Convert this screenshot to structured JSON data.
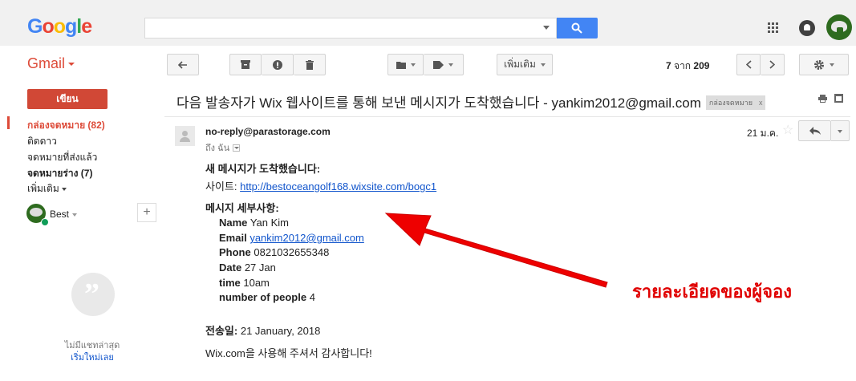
{
  "header": {
    "logo_text": "Google",
    "logo_letters": [
      {
        "ch": "G",
        "color": "#4285f4"
      },
      {
        "ch": "o",
        "color": "#ea4335"
      },
      {
        "ch": "o",
        "color": "#fbbc05"
      },
      {
        "ch": "g",
        "color": "#4285f4"
      },
      {
        "ch": "l",
        "color": "#34a853"
      },
      {
        "ch": "e",
        "color": "#ea4335"
      }
    ],
    "search_value": "",
    "icons": [
      "search-icon",
      "apps-icon",
      "notifications-icon",
      "account-avatar"
    ]
  },
  "toolbar": {
    "gmail_label": "Gmail",
    "more_label": "เพิ่มเติม",
    "page_current": "7",
    "page_sep": "จาก",
    "page_total": "209",
    "icons": [
      "back-icon",
      "archive-icon",
      "report-spam-icon",
      "delete-icon",
      "folder-icon",
      "label-icon",
      "prev-icon",
      "next-icon",
      "settings-icon"
    ]
  },
  "sidebar": {
    "compose_label": "เขียน",
    "items": [
      {
        "label": "กล่องจดหมาย (82)",
        "active": true
      },
      {
        "label": "ติดดาว"
      },
      {
        "label": "จดหมายที่ส่งแล้ว"
      },
      {
        "label": "จดหมายร่าง (7)",
        "bold": true
      },
      {
        "label": "เพิ่มเติม"
      }
    ],
    "hangout_name": "Best",
    "no_chat_text": "ไม่มีแชทล่าสุด",
    "new_chat_link": "เริ่มใหม่เลย"
  },
  "email": {
    "subject": "다음 발송자가 Wix 웹사이트를 통해 보낸 메시지가 도착했습니다 - yankim2012@gmail.com",
    "subject_label": "กล่องจดหมาย",
    "subject_label_close": "x",
    "sender": "no-reply@parastorage.com",
    "to_line": "ถึง ฉัน",
    "date": "21 ม.ค.",
    "body": {
      "heading_new": "새 메시지가 도착했습니다:",
      "site_label": "사이트:",
      "site_url": "http://bestoceangolf168.wixsite.com/bogc1",
      "detail_heading": "메시지 세부사항:",
      "fields": {
        "name_label": "Name",
        "name_value": "Yan Kim",
        "email_label": "Email",
        "email_value": "yankim2012@gmail.com",
        "phone_label": "Phone",
        "phone_value": "0821032655348",
        "date_label": "Date",
        "date_value": "27 Jan",
        "time_label": "time",
        "time_value": "10am",
        "people_label": "number of people",
        "people_value": "4"
      },
      "sent_label": "전송일:",
      "sent_value": "21 January, 2018",
      "thanks": "Wix.com을 사용해 주셔서 감사합니다!"
    }
  },
  "annotation": {
    "text": "รายละเอียดของผู้จอง",
    "color": "#e00000"
  }
}
